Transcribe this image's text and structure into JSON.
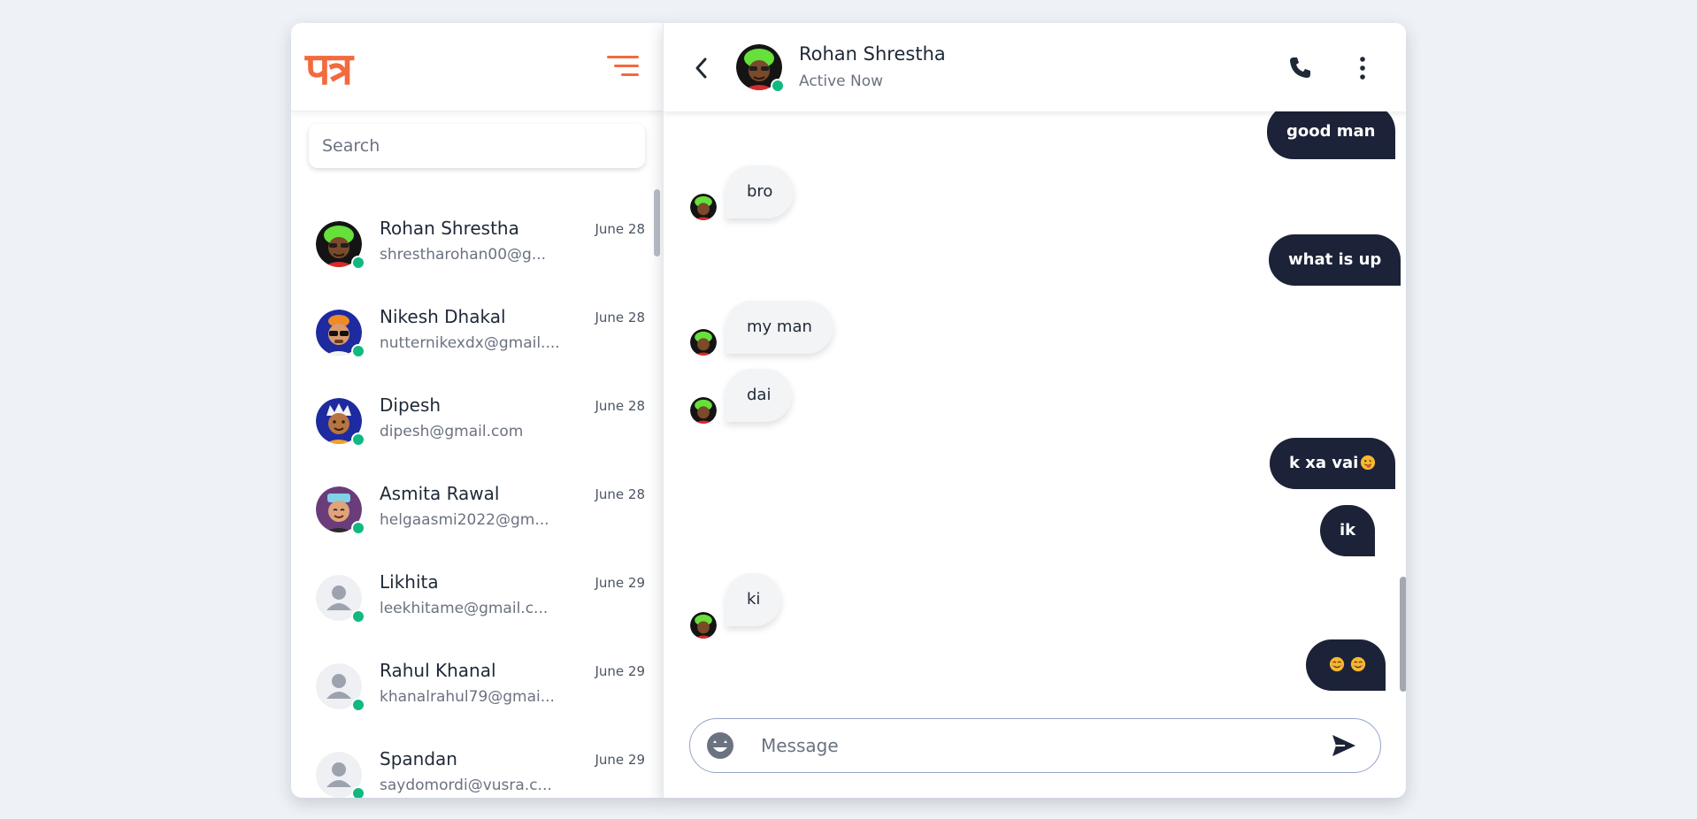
{
  "sidebar": {
    "logo_text": "पत्र",
    "menu_icon": "hamburger-menu-icon",
    "search": {
      "placeholder": "Search",
      "value": ""
    },
    "contacts": [
      {
        "name": "Rohan Shrestha",
        "email": "shrestharohan00@g...",
        "date": "June 28",
        "online": true,
        "avatar": "green-hair-avatar"
      },
      {
        "name": "Nikesh Dhakal",
        "email": "nutternikexdx@gmail....",
        "date": "June 28",
        "online": true,
        "avatar": "sunglasses-avatar"
      },
      {
        "name": "Dipesh",
        "email": "dipesh@gmail.com",
        "date": "June 28",
        "online": true,
        "avatar": "crown-avatar"
      },
      {
        "name": "Asmita Rawal",
        "email": "helgaasmi2022@gm...",
        "date": "June 28",
        "online": true,
        "avatar": "cap-avatar"
      },
      {
        "name": "Likhita",
        "email": "leekhitame@gmail.c...",
        "date": "June 29",
        "online": true,
        "avatar": "default-user-avatar"
      },
      {
        "name": "Rahul Khanal",
        "email": "khanalrahul79@gmai...",
        "date": "June 29",
        "online": true,
        "avatar": "default-user-avatar"
      },
      {
        "name": "Spandan",
        "email": "saydomordi@vusra.c...",
        "date": "June 29",
        "online": true,
        "avatar": "default-user-avatar"
      }
    ]
  },
  "chat": {
    "name": "Rohan Shrestha",
    "status": "Active Now",
    "messages": [
      {
        "direction": "out",
        "text": "good man"
      },
      {
        "direction": "in",
        "text": "bro"
      },
      {
        "direction": "out",
        "text": "what is up"
      },
      {
        "direction": "in",
        "text": "my man"
      },
      {
        "direction": "in",
        "text": "dai"
      },
      {
        "direction": "out",
        "text": "k xa vai",
        "emoji": "tongue-out-emoji"
      },
      {
        "direction": "out",
        "text": "ik"
      },
      {
        "direction": "in",
        "text": "ki"
      },
      {
        "direction": "out",
        "text": "",
        "emoji": "smiling-emoji-pair"
      }
    ],
    "composer": {
      "placeholder": "Message",
      "value": ""
    }
  },
  "colors": {
    "brand": "#f26a3d",
    "outgoing_bubble": "#1c2338",
    "incoming_bubble": "#f3f4f6",
    "online": "#10b981",
    "background": "#eef2f7"
  }
}
